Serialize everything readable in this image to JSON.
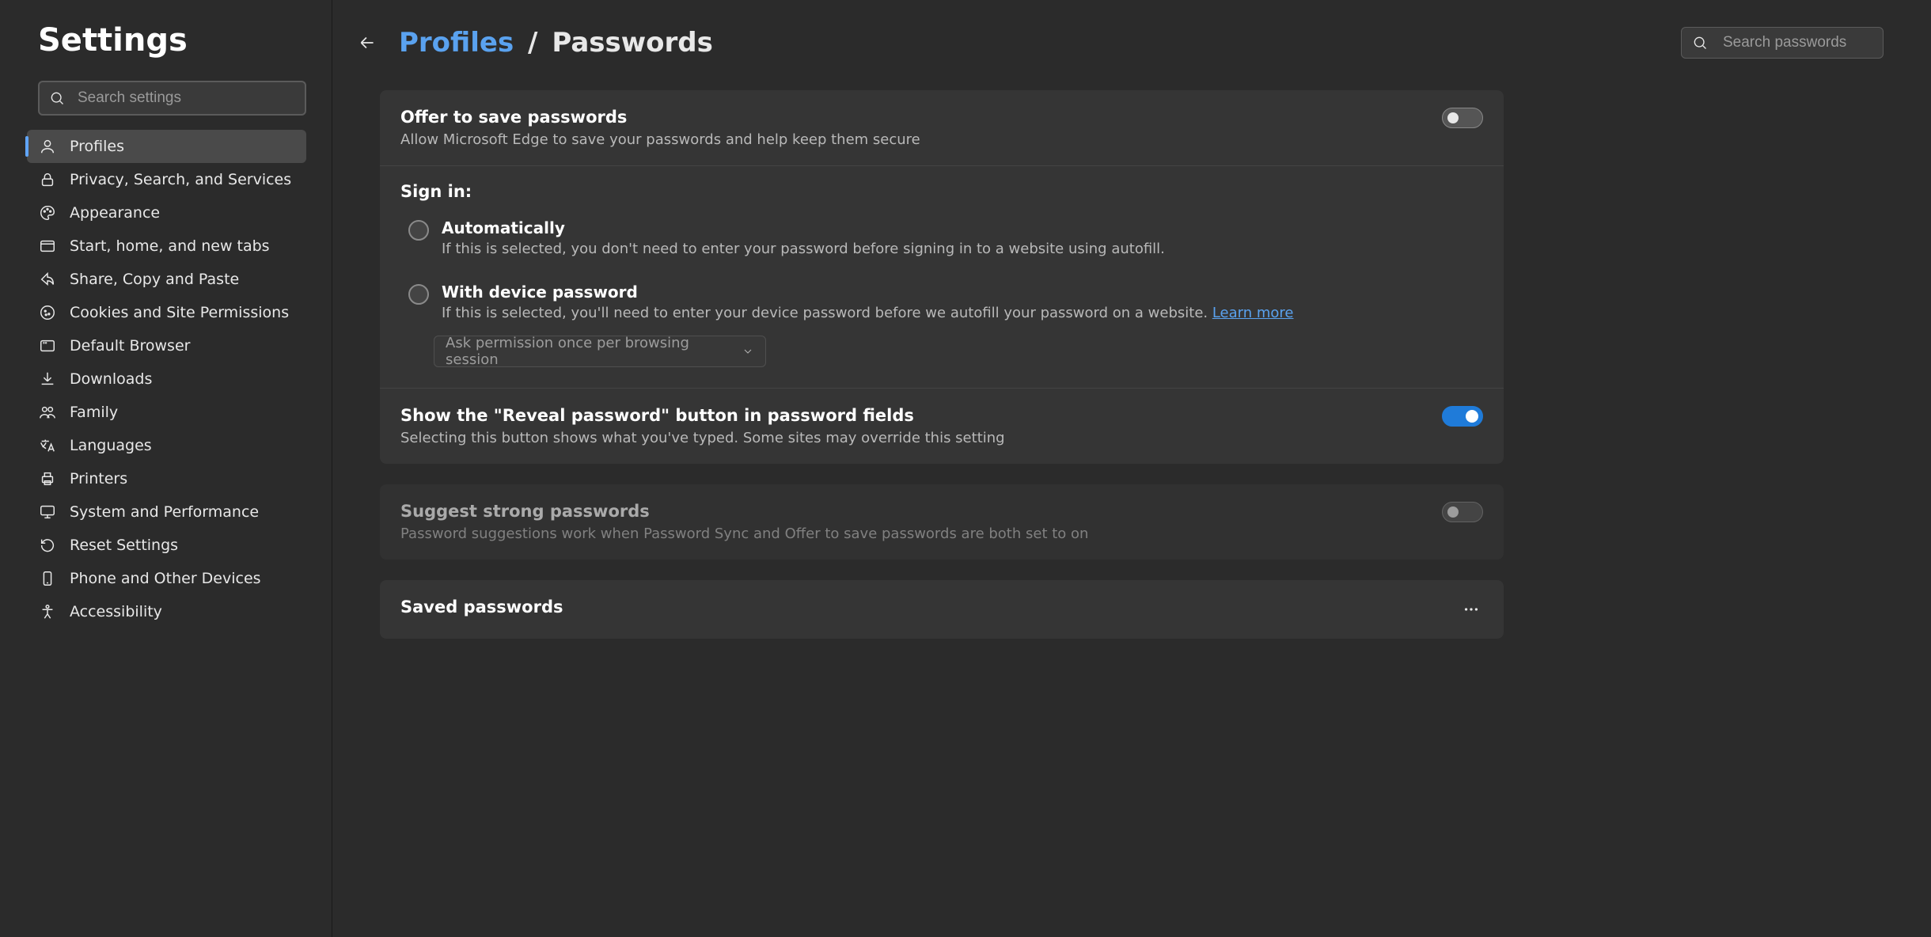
{
  "sidebar": {
    "title": "Settings",
    "search_placeholder": "Search settings",
    "items": [
      {
        "id": "profiles",
        "label": "Profiles",
        "active": true
      },
      {
        "id": "privacy",
        "label": "Privacy, Search, and Services"
      },
      {
        "id": "appearance",
        "label": "Appearance"
      },
      {
        "id": "start",
        "label": "Start, home, and new tabs"
      },
      {
        "id": "share",
        "label": "Share, Copy and Paste"
      },
      {
        "id": "cookies",
        "label": "Cookies and Site Permissions"
      },
      {
        "id": "default-browser",
        "label": "Default Browser"
      },
      {
        "id": "downloads",
        "label": "Downloads"
      },
      {
        "id": "family",
        "label": "Family"
      },
      {
        "id": "languages",
        "label": "Languages"
      },
      {
        "id": "printers",
        "label": "Printers"
      },
      {
        "id": "system",
        "label": "System and Performance"
      },
      {
        "id": "reset",
        "label": "Reset Settings"
      },
      {
        "id": "phone",
        "label": "Phone and Other Devices"
      },
      {
        "id": "accessibility",
        "label": "Accessibility"
      }
    ]
  },
  "header": {
    "breadcrumb_parent": "Profiles",
    "breadcrumb_sep": "/",
    "breadcrumb_current": "Passwords",
    "search_placeholder": "Search passwords"
  },
  "offer_save": {
    "title": "Offer to save passwords",
    "desc": "Allow Microsoft Edge to save your passwords and help keep them secure",
    "on": false
  },
  "sign_in": {
    "title": "Sign in:",
    "auto": {
      "title": "Automatically",
      "desc": "If this is selected, you don't need to enter your password before signing in to a website using autofill."
    },
    "device": {
      "title": "With device password",
      "desc_before": "If this is selected, you'll need to enter your device password before we autofill your password on a website. ",
      "learn_more": "Learn more"
    },
    "select_value": "Ask permission once per browsing session"
  },
  "reveal": {
    "title": "Show the \"Reveal password\" button in password fields",
    "desc": "Selecting this button shows what you've typed. Some sites may override this setting",
    "on": true
  },
  "suggest": {
    "title": "Suggest strong passwords",
    "desc": "Password suggestions work when Password Sync and Offer to save passwords are both set to on",
    "on": false
  },
  "saved": {
    "title": "Saved passwords"
  }
}
